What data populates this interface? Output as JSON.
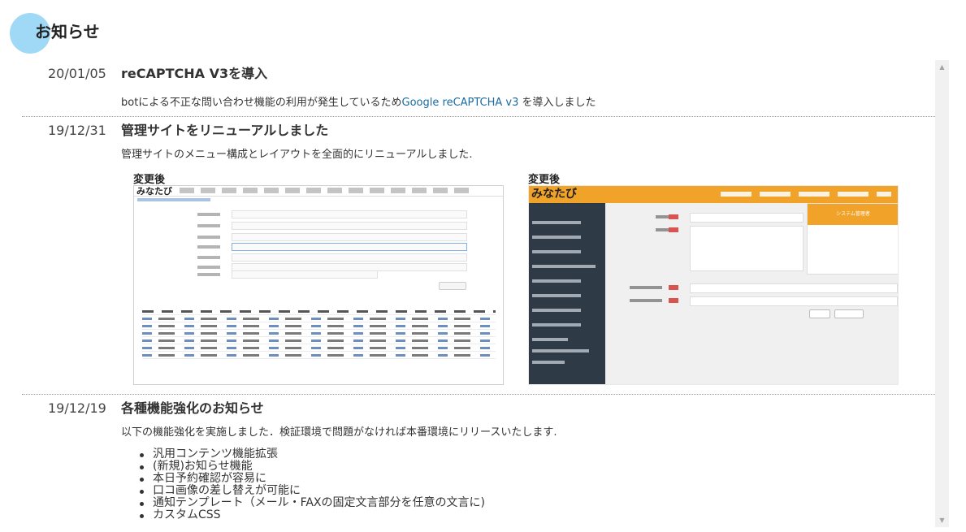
{
  "page": {
    "title": "お知らせ"
  },
  "news": [
    {
      "date": "20/01/05",
      "title": "reCAPTCHA V3を導入",
      "body_prefix": "botによる不正な問い合わせ機能の利用が発生しているため",
      "body_link": "Google reCAPTCHA v3",
      "body_suffix": " を導入しました"
    },
    {
      "date": "19/12/31",
      "title": "管理サイトをリニューアルしました",
      "body": "管理サイトのメニュー構成とレイアウトを全面的にリニューアルしました.",
      "screenshots": [
        {
          "label": "変更後",
          "logo": "みなたび"
        },
        {
          "label": "変更後",
          "logo": "みなたび",
          "panel_title": "システム管理者"
        }
      ]
    },
    {
      "date": "19/12/19",
      "title": "各種機能強化のお知らせ",
      "body": "以下の機能強化を実施しました．検証環境で問題がなければ本番環境にリリースいたします.",
      "features": [
        "汎用コンテンツ機能拡張",
        "(新規)お知らせ機能",
        "本日予約確認が容易に",
        "口コ画像の差し替えが可能に",
        "通知テンプレート（メール・FAXの固定文言部分を任意の文言に)",
        "カスタムCSS"
      ]
    }
  ],
  "colors": {
    "accent_circle": "#9fd9f5",
    "link": "#1a6aa0",
    "orange": "#f0a229",
    "sidebar": "#2e3a46"
  },
  "icons": {
    "scroll_up": "▲",
    "scroll_down": "▼"
  }
}
